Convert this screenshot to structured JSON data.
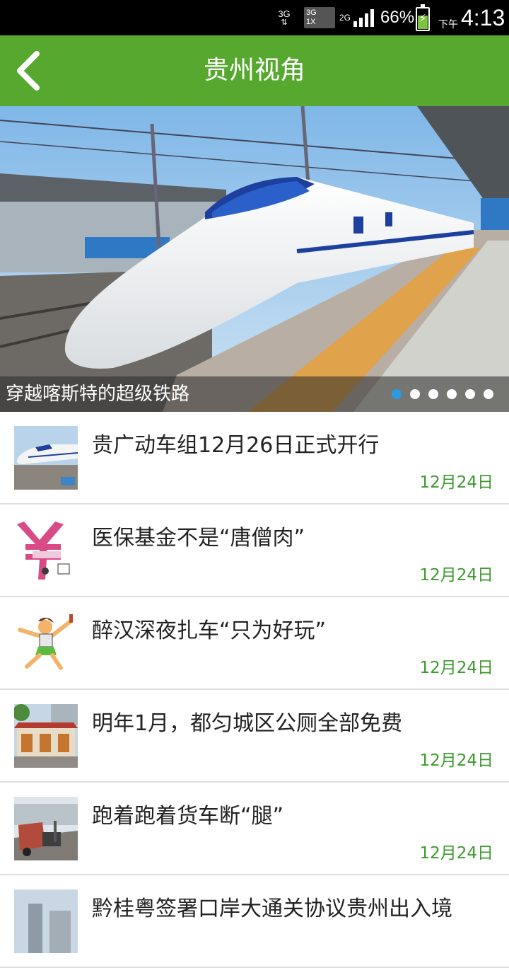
{
  "status_bar": {
    "network_top": "3G",
    "sim_line1": "3G",
    "sim_line2": "1X",
    "network_2g": "2G",
    "battery_percent": "66%",
    "ampm": "下午",
    "time": "4:13"
  },
  "header": {
    "title": "贵州视角",
    "accent_color": "#56a82f"
  },
  "banner": {
    "caption": "穿越喀斯特的超级铁路",
    "slide_count": 6,
    "active_slide": 1
  },
  "news": [
    {
      "title": "贵广动车组12月26日正式开行",
      "date": "12月24日",
      "thumb": "train-thumbnail"
    },
    {
      "title": "医保基金不是“唐僧肉”",
      "date": "12月24日",
      "thumb": "yuan-cartoon-thumbnail"
    },
    {
      "title": "醉汉深夜扎车“只为好玩”",
      "date": "12月24日",
      "thumb": "drunk-man-cartoon-thumbnail"
    },
    {
      "title": "明年1月，都匀城区公厕全部免费",
      "date": "12月24日",
      "thumb": "building-thumbnail"
    },
    {
      "title": "跑着跑着货车断“腿”",
      "date": "12月24日",
      "thumb": "truck-thumbnail"
    },
    {
      "title": "黔桂粤签署口岸大通关协议贵州出入境",
      "date": "",
      "thumb": "city-thumbnail"
    }
  ]
}
